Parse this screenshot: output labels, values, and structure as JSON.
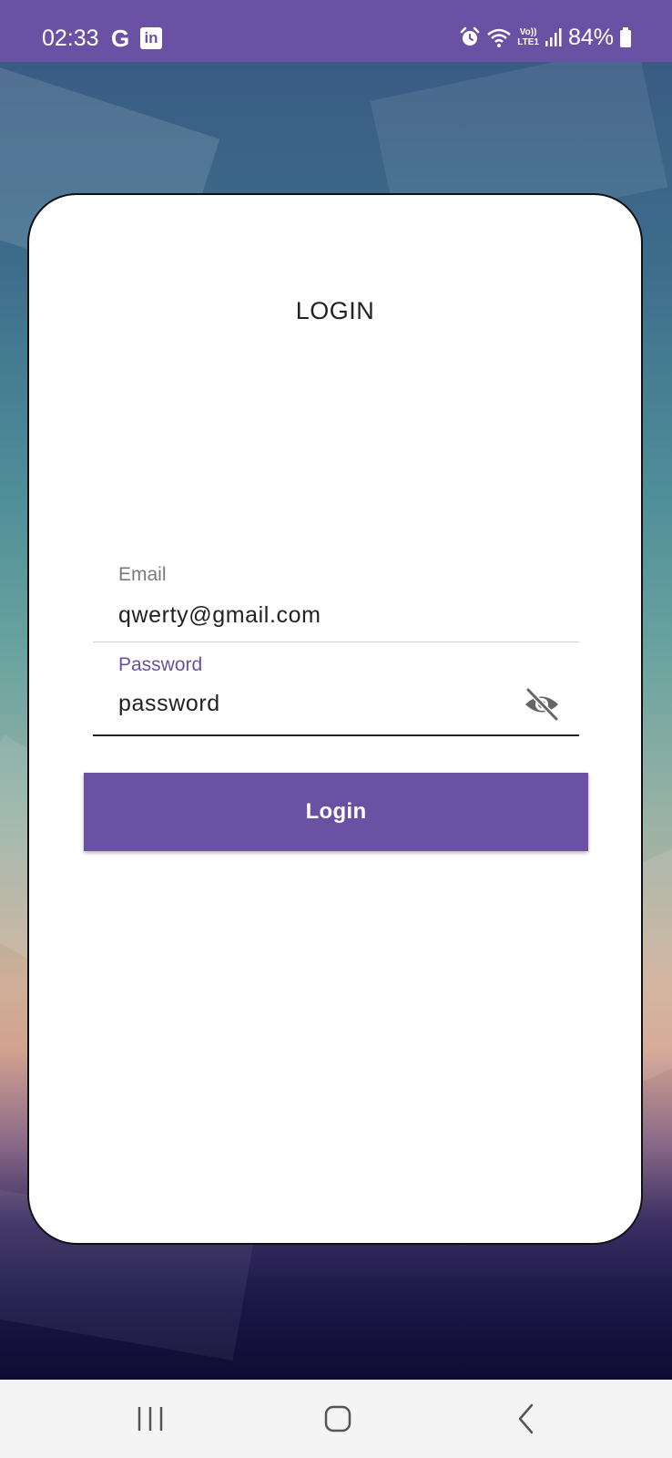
{
  "status_bar": {
    "time": "02:33",
    "g_label": "G",
    "linkedin_label": "in",
    "volte_top": "Vo))",
    "volte_bottom": "LTE1",
    "battery": "84%",
    "icons": [
      "google-icon",
      "linkedin-icon",
      "alarm-icon",
      "wifi-icon",
      "volte-icon",
      "signal-icon",
      "battery-icon"
    ]
  },
  "login_card": {
    "title": "LOGIN",
    "email": {
      "label": "Email",
      "value": "qwerty@gmail.com"
    },
    "password": {
      "label": "Password",
      "value": "password",
      "toggle_icon": "visibility-off-icon"
    },
    "login_button": "Login"
  },
  "nav_bar": {
    "icons": [
      "recents-icon",
      "home-icon",
      "back-icon"
    ]
  },
  "colors": {
    "accent": "#6a51a3",
    "card": "#ffffff",
    "nav_bar": "#f4f4f4"
  }
}
